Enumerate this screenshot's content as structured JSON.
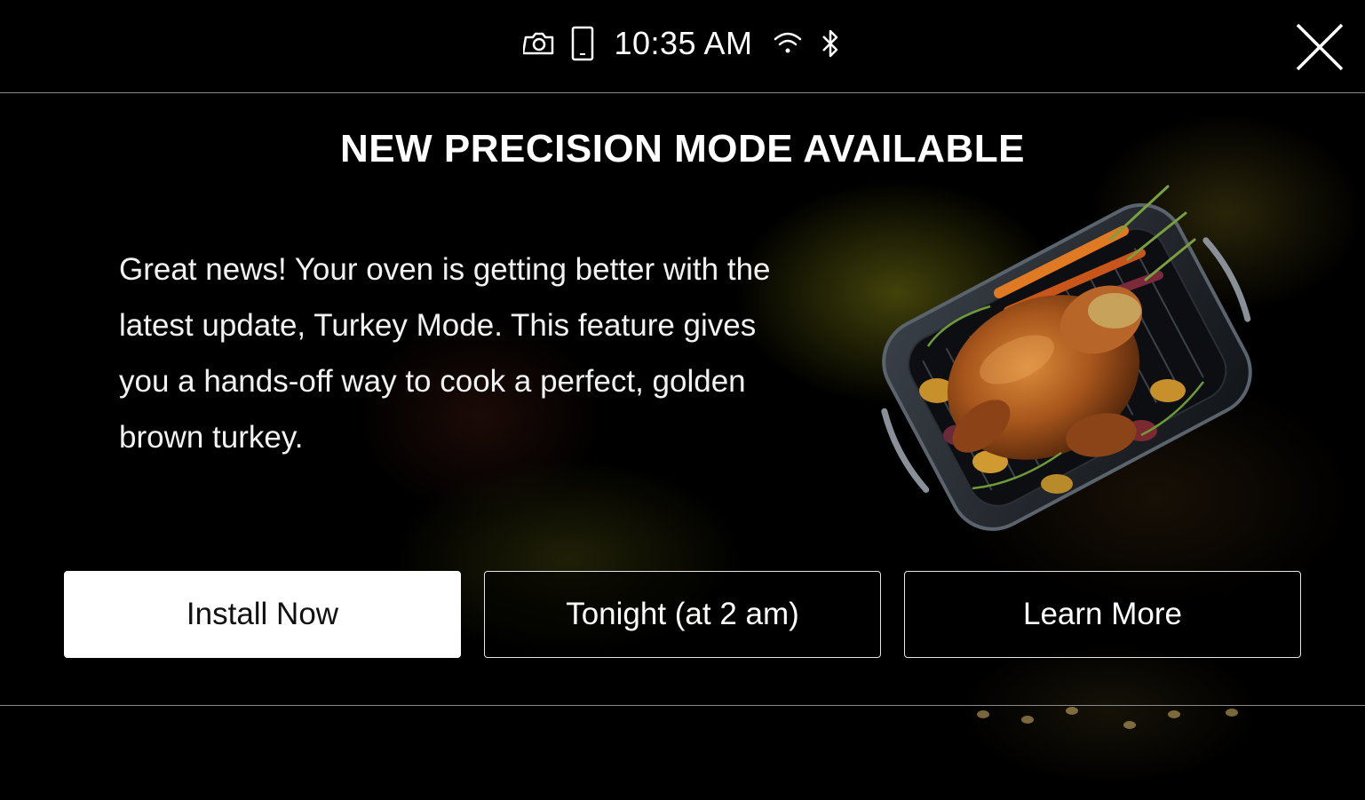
{
  "status_bar": {
    "time": "10:35 AM",
    "icons": [
      "camera-icon",
      "phone-icon",
      "wifi-icon",
      "bluetooth-icon"
    ]
  },
  "dialog": {
    "title": "NEW PRECISION MODE AVAILABLE",
    "body": "Great news! Your oven is getting better with the latest update, Turkey Mode. This feature gives you a hands-off way to cook a perfect, golden brown turkey.",
    "image": "roast-turkey-image"
  },
  "actions": {
    "install_label": "Install Now",
    "tonight_label": "Tonight (at 2 am)",
    "learn_label": "Learn More"
  },
  "colors": {
    "background": "#000000",
    "text": "#ffffff",
    "primary_button_bg": "#ffffff",
    "primary_button_text": "#111111",
    "divider": "#8a8a8a"
  }
}
